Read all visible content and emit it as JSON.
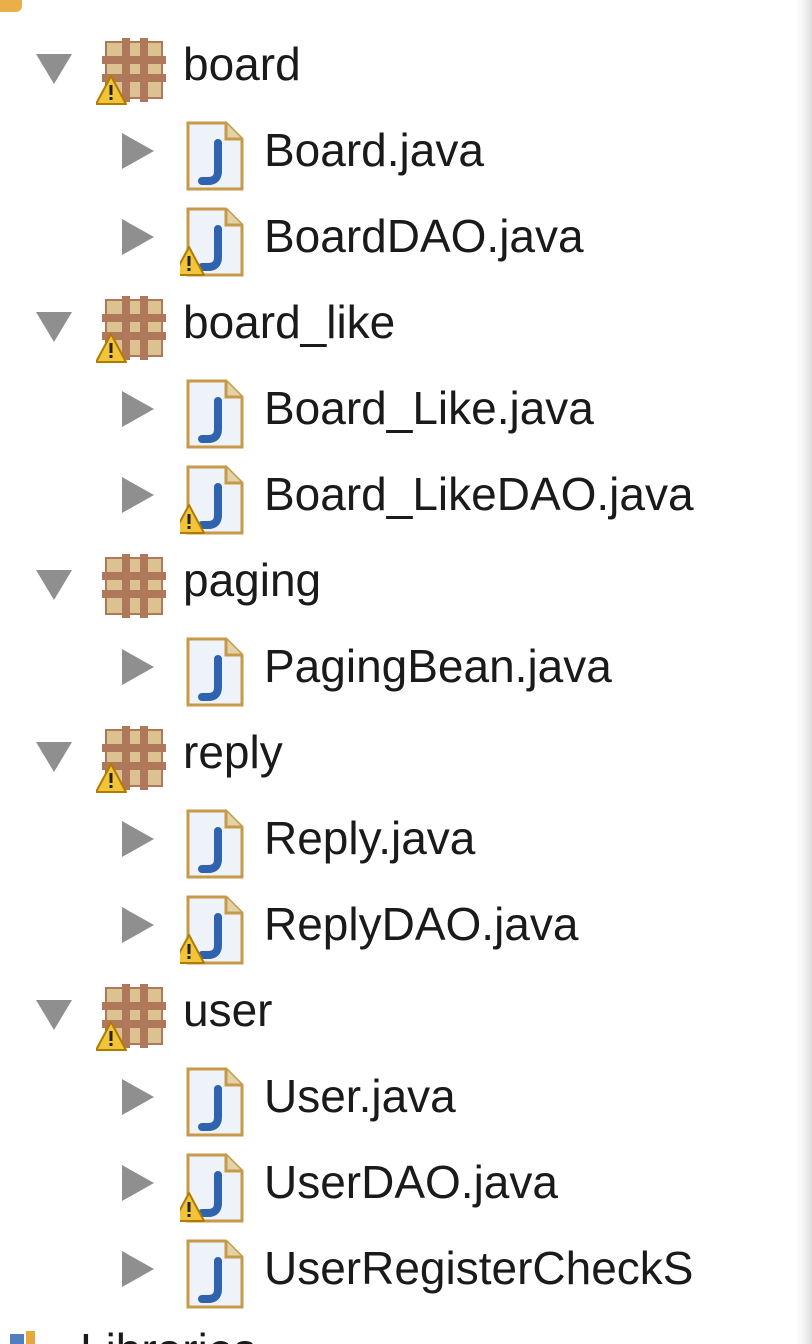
{
  "tree": {
    "items": [
      {
        "type": "package",
        "label": "board",
        "warning": true,
        "expanded": true
      },
      {
        "type": "file",
        "label": "Board.java",
        "warning": false,
        "expanded": false
      },
      {
        "type": "file",
        "label": "BoardDAO.java",
        "warning": true,
        "expanded": false
      },
      {
        "type": "package",
        "label": "board_like",
        "warning": true,
        "expanded": true
      },
      {
        "type": "file",
        "label": "Board_Like.java",
        "warning": false,
        "expanded": false
      },
      {
        "type": "file",
        "label": "Board_LikeDAO.java",
        "warning": true,
        "expanded": false
      },
      {
        "type": "package",
        "label": "paging",
        "warning": false,
        "expanded": true
      },
      {
        "type": "file",
        "label": "PagingBean.java",
        "warning": false,
        "expanded": false
      },
      {
        "type": "package",
        "label": "reply",
        "warning": true,
        "expanded": true
      },
      {
        "type": "file",
        "label": "Reply.java",
        "warning": false,
        "expanded": false
      },
      {
        "type": "file",
        "label": "ReplyDAO.java",
        "warning": true,
        "expanded": false
      },
      {
        "type": "package",
        "label": "user",
        "warning": true,
        "expanded": true
      },
      {
        "type": "file",
        "label": "User.java",
        "warning": false,
        "expanded": false
      },
      {
        "type": "file",
        "label": "UserDAO.java",
        "warning": true,
        "expanded": false
      },
      {
        "type": "file",
        "label": "UserRegisterCheckS",
        "warning": false,
        "expanded": false
      }
    ],
    "partial_bottom_label": "Libraries"
  },
  "icons": {
    "package": "package-icon",
    "file": "java-file-icon",
    "warning": "warning-icon",
    "expanded": "disclosure-expanded-icon",
    "collapsed": "disclosure-collapsed-icon"
  },
  "colors": {
    "arrow": "#8f8f8f",
    "text": "#1a1a1a",
    "package_brown": "#b0785a",
    "package_fill": "#dcc291",
    "java_blue": "#2f63ad",
    "warning_fill": "#f2c43a",
    "warning_border": "#b07b00"
  }
}
